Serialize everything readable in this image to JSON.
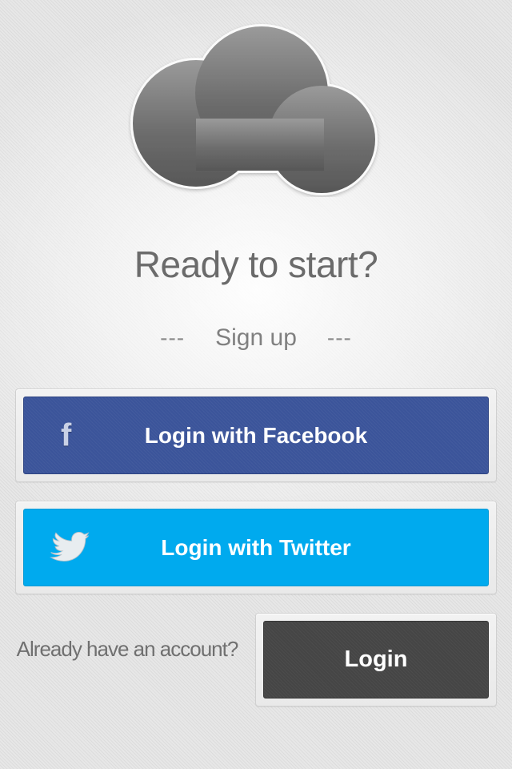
{
  "logo": {
    "icon": "cloud-icon"
  },
  "headline": "Ready to start?",
  "divider": {
    "left": "---",
    "label": "Sign up",
    "right": "---"
  },
  "facebook": {
    "label": "Login with Facebook",
    "icon": "facebook-icon",
    "icon_glyph": "f",
    "color": "#3b549a"
  },
  "twitter": {
    "label": "Login with Twitter",
    "icon": "twitter-bird-icon",
    "color": "#00aaee"
  },
  "account": {
    "prompt": "Already have an account?"
  },
  "login": {
    "label": "Login",
    "color": "#454545"
  }
}
